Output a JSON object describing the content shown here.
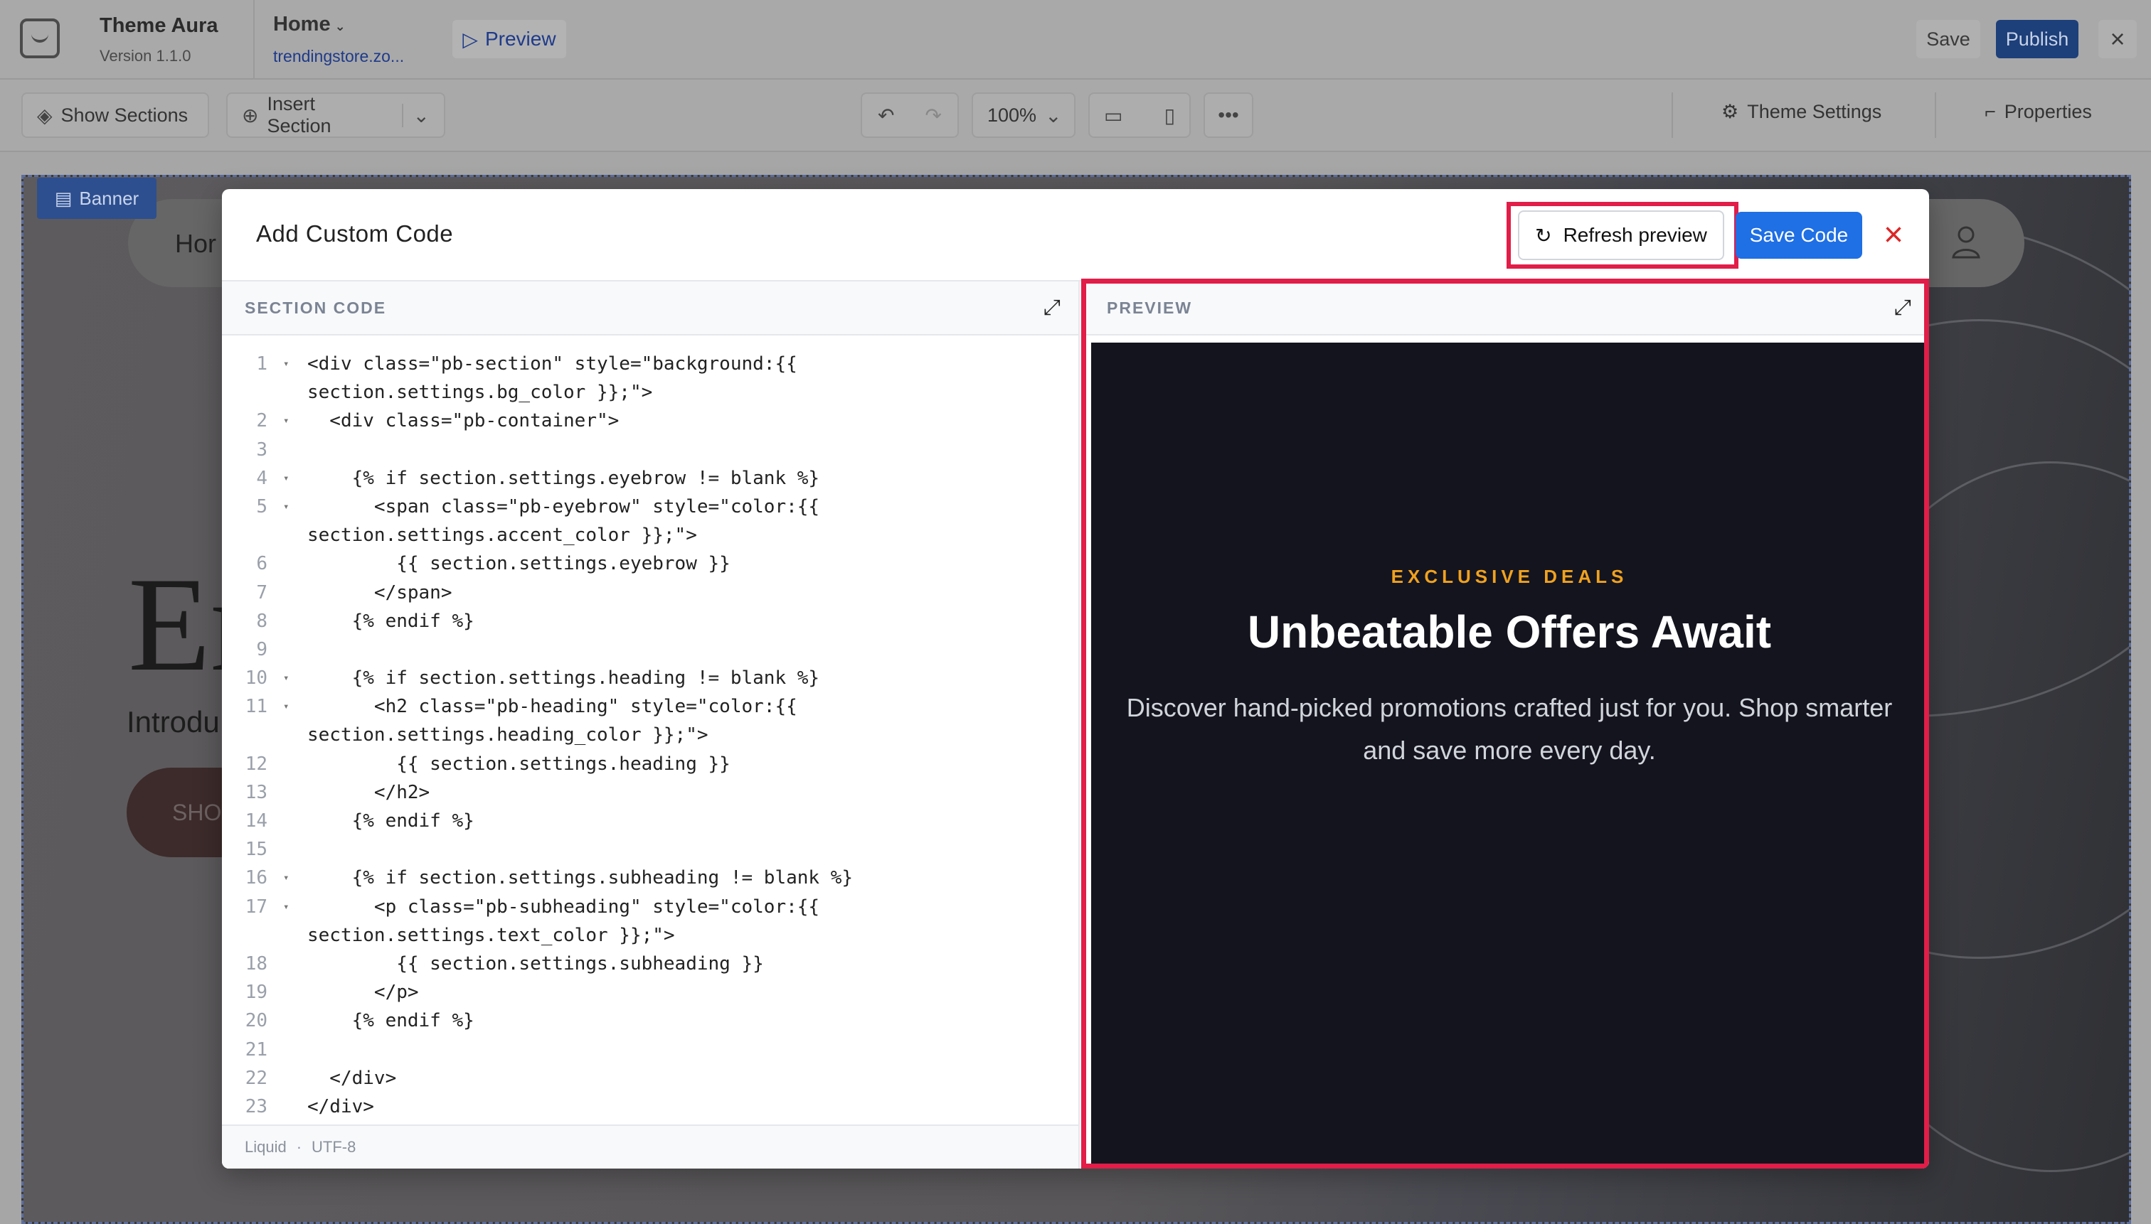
{
  "topbar": {
    "theme_name": "Theme Aura",
    "theme_version": "Version 1.1.0",
    "page_name": "Home",
    "page_url": "trendingstore.zo...",
    "preview_label": "Preview",
    "save_label": "Save",
    "publish_label": "Publish"
  },
  "toolbar": {
    "show_sections": "Show Sections",
    "insert_section": "Insert Section",
    "zoom": "100%",
    "theme_settings": "Theme Settings",
    "properties": "Properties"
  },
  "canvas": {
    "banner_tag": "Banner",
    "nav_home": "Hor",
    "hero_big": "Er",
    "hero_intro": "Introdu",
    "hero_button": "SHO"
  },
  "modal": {
    "title": "Add Custom Code",
    "refresh_label": "Refresh preview",
    "save_code_label": "Save Code",
    "section_code_label": "SECTION CODE",
    "preview_label": "PREVIEW",
    "footer_language": "Liquid",
    "footer_separator": "·",
    "footer_encoding": "UTF-8"
  },
  "code_lines": [
    {
      "n": "1",
      "fold": true,
      "text": "<div class=\"pb-section\" style=\"background:{{"
    },
    {
      "n": "",
      "fold": false,
      "text": "section.settings.bg_color }};\">"
    },
    {
      "n": "2",
      "fold": true,
      "text": "  <div class=\"pb-container\">"
    },
    {
      "n": "3",
      "fold": false,
      "text": ""
    },
    {
      "n": "4",
      "fold": true,
      "text": "    {% if section.settings.eyebrow != blank %}"
    },
    {
      "n": "5",
      "fold": true,
      "text": "      <span class=\"pb-eyebrow\" style=\"color:{{"
    },
    {
      "n": "",
      "fold": false,
      "text": "section.settings.accent_color }};\">"
    },
    {
      "n": "6",
      "fold": false,
      "text": "        {{ section.settings.eyebrow }}"
    },
    {
      "n": "7",
      "fold": false,
      "text": "      </span>"
    },
    {
      "n": "8",
      "fold": false,
      "text": "    {% endif %}"
    },
    {
      "n": "9",
      "fold": false,
      "text": ""
    },
    {
      "n": "10",
      "fold": true,
      "text": "    {% if section.settings.heading != blank %}"
    },
    {
      "n": "11",
      "fold": true,
      "text": "      <h2 class=\"pb-heading\" style=\"color:{{"
    },
    {
      "n": "",
      "fold": false,
      "text": "section.settings.heading_color }};\">"
    },
    {
      "n": "12",
      "fold": false,
      "text": "        {{ section.settings.heading }}"
    },
    {
      "n": "13",
      "fold": false,
      "text": "      </h2>"
    },
    {
      "n": "14",
      "fold": false,
      "text": "    {% endif %}"
    },
    {
      "n": "15",
      "fold": false,
      "text": ""
    },
    {
      "n": "16",
      "fold": true,
      "text": "    {% if section.settings.subheading != blank %}"
    },
    {
      "n": "17",
      "fold": true,
      "text": "      <p class=\"pb-subheading\" style=\"color:{{"
    },
    {
      "n": "",
      "fold": false,
      "text": "section.settings.text_color }};\">"
    },
    {
      "n": "18",
      "fold": false,
      "text": "        {{ section.settings.subheading }}"
    },
    {
      "n": "19",
      "fold": false,
      "text": "      </p>"
    },
    {
      "n": "20",
      "fold": false,
      "text": "    {% endif %}"
    },
    {
      "n": "21",
      "fold": false,
      "text": ""
    },
    {
      "n": "22",
      "fold": false,
      "text": "  </div>"
    },
    {
      "n": "23",
      "fold": false,
      "text": "</div>"
    }
  ],
  "preview": {
    "eyebrow": "EXCLUSIVE DEALS",
    "heading": "Unbeatable Offers Await",
    "subheading": "Discover hand-picked promotions crafted just for you. Shop smarter and save more every day.",
    "bg_color": "#14141f",
    "accent_color": "#f0a21e",
    "heading_color": "#ffffff",
    "text_color": "#d1d5db"
  },
  "colors": {
    "highlight": "#e11d48",
    "primary_button": "#1f6fe5",
    "close_icon": "#dc2626"
  }
}
